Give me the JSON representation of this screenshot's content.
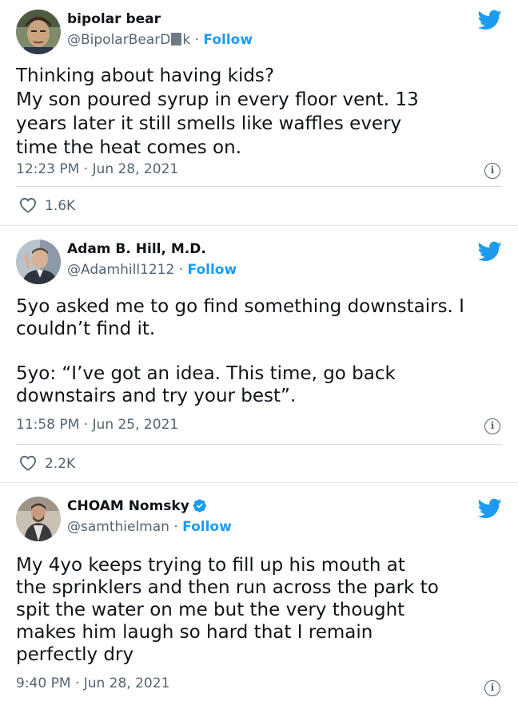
{
  "tweets": [
    {
      "name": "bipolar bear",
      "handle_prefix": "@BipolarBearD",
      "handle_suffix": "k",
      "sep": " · ",
      "follow": "Follow",
      "text": "Thinking about having kids?\nMy son poured syrup in every floor vent. 13\nyears later it still smells like waffles every\ntime the heat comes on.",
      "timestamp": "12:23 PM · Jun 28, 2021",
      "likes": "1.6K"
    },
    {
      "name": "Adam B. Hill, M.D.",
      "handle": "@Adamhill1212",
      "sep": " · ",
      "follow": "Follow",
      "text": "5yo asked me to go find something downstairs. I\ncouldn’t find it.\n\n5yo: “I’ve got an idea. This time, go back\ndownstairs and try your best”.",
      "timestamp": "11:58 PM · Jun 25, 2021",
      "likes": "2.2K"
    },
    {
      "name": "CHOAM Nomsky",
      "handle": "@samthielman",
      "sep": " · ",
      "follow": "Follow",
      "verified": true,
      "text": "My 4yo keeps trying to fill up his mouth at\nthe sprinklers and then run across the park to\nspit the water on me but the very thought\nmakes him laugh so hard that I remain\nperfectly dry",
      "timestamp": "9:40 PM · Jun 28, 2021"
    }
  ],
  "icons": {
    "brand": "twitter-bird-icon",
    "info": "info-icon",
    "like": "heart-icon",
    "verified": "verified-badge-icon"
  },
  "colors": {
    "accent": "#1d9bf0",
    "muted": "#536471",
    "text": "#0f1419",
    "divider": "#cfd9de"
  }
}
